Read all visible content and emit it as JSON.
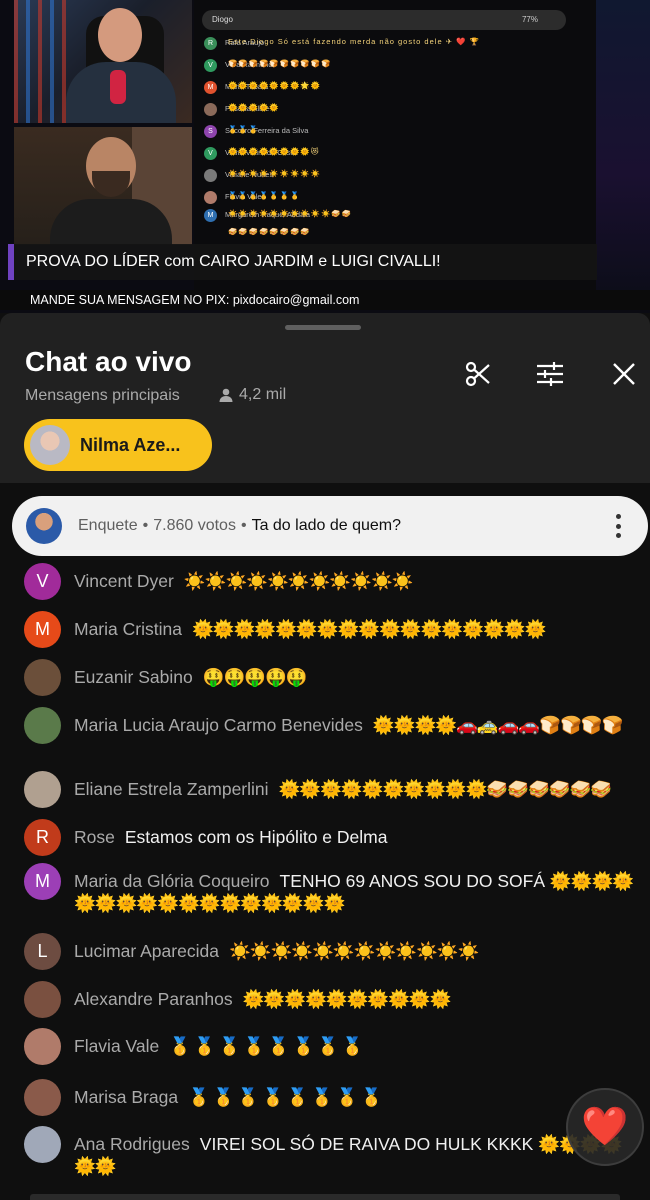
{
  "video": {
    "stream_chat_title": "Diogo",
    "stream_chat_percent": "77%",
    "stream_chat_rows": [
      {
        "initial": "R",
        "color": "#3a8f5a",
        "name": "Rafa Araujo",
        "message": "Este Diogo Só está fazendo merda não gosto dele ✈ ❤️ 🏆"
      },
      {
        "initial": "V",
        "color": "#2f9a5f",
        "name": "Vera Raimundo",
        "message": "🍞🍞🍞🍞🍞🍞🍞🍞🍞🍞"
      },
      {
        "initial": "M",
        "color": "#e0522e",
        "name": "Maria Tabata",
        "message": "🌞🌞🌞🌞🌞🌞🌞🌟🌞"
      },
      {
        "initial": "",
        "color": "#8b6a5a",
        "name": "Priscilla Aline",
        "message": "🌞🌞🌞🌞🌞"
      },
      {
        "initial": "S",
        "color": "#8e44ad",
        "name": "Socorro Ferreira da Silva",
        "message": "🥇🥇🥇"
      },
      {
        "initial": "V",
        "color": "#2f9a5f",
        "name": "Vilma Vieira da Costa",
        "message": "🌞🌞🌞🌞🌞🌞🌞🌞😻"
      },
      {
        "initial": "",
        "color": "#7a7a7a",
        "name": "Viviane Nunes",
        "message": "☀️☀️☀️☀️☀️☀️☀️☀️☀️"
      },
      {
        "initial": "",
        "color": "#b07b6a",
        "name": "Flavia Vale",
        "message": "🥇🥇🥇🥇🥇🥇🥇"
      },
      {
        "initial": "M",
        "color": "#2f6fb0",
        "name": "Margareth Raquel Abdala",
        "message": "☀️☀️☀️☀️☀️☀️☀️☀️☀️☀️🥪🥪"
      },
      {
        "initial": "",
        "color": "#0b0b0d",
        "name": "",
        "message": "🥪🥪🥪🥪🥪🥪🥪🥪"
      }
    ],
    "banner": "PROVA DO LÍDER com CAIRO JARDIM e LUIGI CIVALLI!",
    "pix": "MANDE SUA MENSAGEM NO PIX: pixdocairo@gmail.com"
  },
  "chat": {
    "title": "Chat ao vivo",
    "subtitle": "Mensagens principais",
    "viewers": "4,2 mil",
    "pinned_user": "Nilma Aze...",
    "header_icons": [
      "scissors-icon",
      "tune-icon",
      "close-icon"
    ]
  },
  "poll": {
    "label": "Enquete",
    "votes": "7.860 votos",
    "question": "Ta do lado de quem?"
  },
  "messages": [
    {
      "author": "Vincent Dyer",
      "text": "",
      "emoji": "☀️☀️☀️☀️☀️☀️☀️☀️☀️☀️☀️",
      "initial": "V",
      "color": "#a12b9a"
    },
    {
      "author": "Maria Cristina",
      "text": "",
      "emoji": "🌞🌞🌞🌞🌞🌞🌞🌞🌞🌞🌞🌞🌞🌞🌞🌞🌞",
      "initial": "M",
      "color": "#e64a19"
    },
    {
      "author": "Euzanir Sabino",
      "text": "",
      "emoji": "🤑🤑🤑🤑🤑",
      "initial": "",
      "color": "#6b4f3a"
    },
    {
      "author": "Maria Lucia Araujo Carmo Benevides",
      "text": "",
      "emoji": "🌞🌞🌞🌞🚗🚕🚗🚗🍞🍞🍞🍞",
      "initial": "",
      "color": "#5a7a4a"
    },
    {
      "author": "Eliane Estrela Zamperlini",
      "text": "",
      "emoji": "🌞🌞🌞🌞🌞🌞🌞🌞🌞🌞🥪🥪🥪🥪🥪🥪",
      "initial": "",
      "color": "#b0a090"
    },
    {
      "author": "Rose",
      "text": "Estamos com os Hipólito e Delma",
      "emoji": "",
      "initial": "R",
      "color": "#c13b1b"
    },
    {
      "author": "Maria da Glória Coqueiro",
      "text": "TENHO 69 ANOS SOU DO SOFÁ",
      "emoji": "🌞🌞🌞🌞🌞🌞🌞🌞🌞🌞🌞🌞🌞🌞🌞🌞🌞",
      "initial": "M",
      "color": "#9c3fb6"
    },
    {
      "author": "Lucimar Aparecida",
      "text": "",
      "emoji": "☀️☀️☀️☀️☀️☀️☀️☀️☀️☀️☀️☀️",
      "initial": "L",
      "color": "#6d4c41"
    },
    {
      "author": "Alexandre Paranhos",
      "text": "",
      "emoji": "🌞🌞🌞🌞🌞🌞🌞🌞🌞🌞",
      "initial": "",
      "color": "#7a5040"
    },
    {
      "author": "Flavia Vale",
      "text": "",
      "emoji": "🥇 🥇 🥇 🥇 🥇 🥇 🥇 🥇",
      "initial": "",
      "color": "#b07b6a"
    },
    {
      "author": "Marisa Braga",
      "text": "",
      "emoji": "🥇 🥇 🥇 🥇 🥇 🥇 🥇 🥇",
      "initial": "",
      "color": "#8a5a4a"
    },
    {
      "author": "Ana Rodrigues",
      "text": "VIREI SOL SÓ DE RAIVA DO HULK KKKK",
      "emoji": "🌞🌞🌞🌞🌞🌞",
      "initial": "",
      "color": "#a0a8b8"
    }
  ],
  "reaction": "❤️",
  "colors": {
    "pill_bg": "#f8c21c",
    "banner_accent": "#6f42c1",
    "author": "#aaaaaa"
  }
}
